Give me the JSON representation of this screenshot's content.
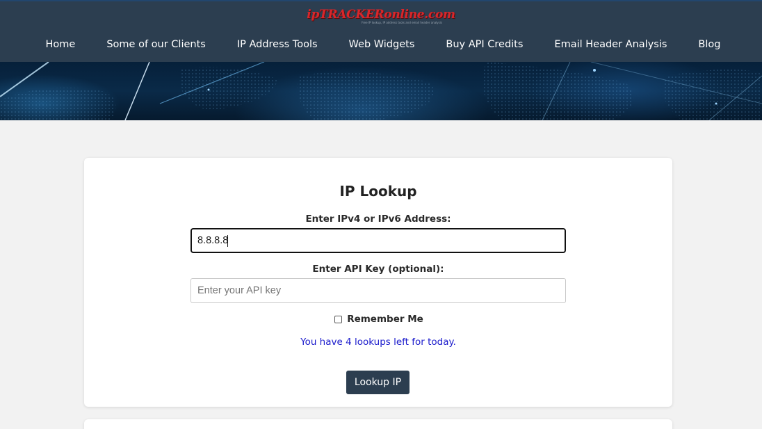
{
  "header": {
    "logo_text": "ipTRACKERonline.com",
    "logo_tagline": "Free IP lookup, IP address tools and email header analysis"
  },
  "nav": {
    "items": [
      {
        "label": "Home"
      },
      {
        "label": "Some of our Clients"
      },
      {
        "label": "IP Address Tools"
      },
      {
        "label": "Web Widgets"
      },
      {
        "label": "Buy API Credits"
      },
      {
        "label": "Email Header Analysis"
      },
      {
        "label": "Blog"
      }
    ]
  },
  "lookup": {
    "title": "IP Lookup",
    "ip_label": "Enter IPv4 or IPv6 Address:",
    "ip_value": "8.8.8.8",
    "api_label": "Enter API Key (optional):",
    "api_placeholder": "Enter your API key",
    "api_value": "",
    "remember_label": "Remember Me",
    "remember_checked": false,
    "limit_text": "You have 4 lookups left for today.",
    "button_label": "Lookup IP"
  },
  "colors": {
    "header_bg": "#2c3e50",
    "logo_red": "#d9262a",
    "page_bg": "#f2f2f2",
    "button_bg": "#2c3e50",
    "limit_text": "#1a1acc"
  }
}
